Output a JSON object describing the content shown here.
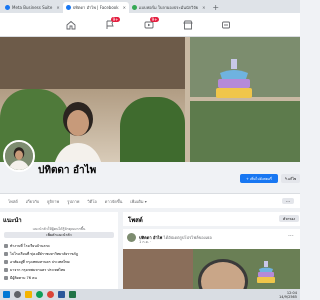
{
  "browser": {
    "tabs": [
      {
        "label": "Meta Business Suite",
        "active": false,
        "color": "#1877f2"
      },
      {
        "label": "ปทิตดา อำไพ | Facebook",
        "active": true,
        "color": "#1877f2"
      },
      {
        "label": "แบบฟอร์ม ใบลาผองประมั่นนักวิจัย",
        "active": false,
        "color": "#34a853"
      }
    ],
    "new_tab": "+"
  },
  "nav": {
    "friends_badge": "9+",
    "watch_badge": "9+"
  },
  "profile": {
    "name": "ปทิตดา อำไพ",
    "add_story": "เพิ่มไปยังสตอรี่",
    "edit_profile": "แก้ไข"
  },
  "profile_tabs": [
    "โพสต์",
    "เกี่ยวกับ",
    "ยูจิกาพ",
    "รูปภาพ",
    "วิดีโอ",
    "ดาวจัดขึ้น",
    "เพิ่มเติม ▾"
  ],
  "intro": {
    "title": "แนะนำ",
    "bio_prompt": "แนะนำตัวให้ผู้คนได้รู้จักคุณมากขึ้น",
    "add_bio": "เพิ่มคำแนะนำตัว",
    "rows": [
      "ทำงานที่ โรงเรียนบ้านลาด",
      "ไปโรงเรียนที่ ทุ่งเจดีย์ราชมหาวิทยาลัยราชภัฎ",
      "อาศัยอยู่ที่ กรุงเทพมหานคร ประเทศไทย",
      "มาจาก กรุงเทพมหานคร ประเทศไทย",
      "มีผู้ติดตาม 76 คน"
    ]
  },
  "posts": {
    "title": "โพสต์",
    "filter": "ตัวกรอง",
    "post": {
      "author": "ปทิตดา อำไพ",
      "action": "ได้อัปเดตรูปโปรไฟล์ของเธอ",
      "date": "1 ก.ย. ·"
    }
  },
  "taskbar": {
    "time": "12:04",
    "date": "14/9/2565"
  }
}
